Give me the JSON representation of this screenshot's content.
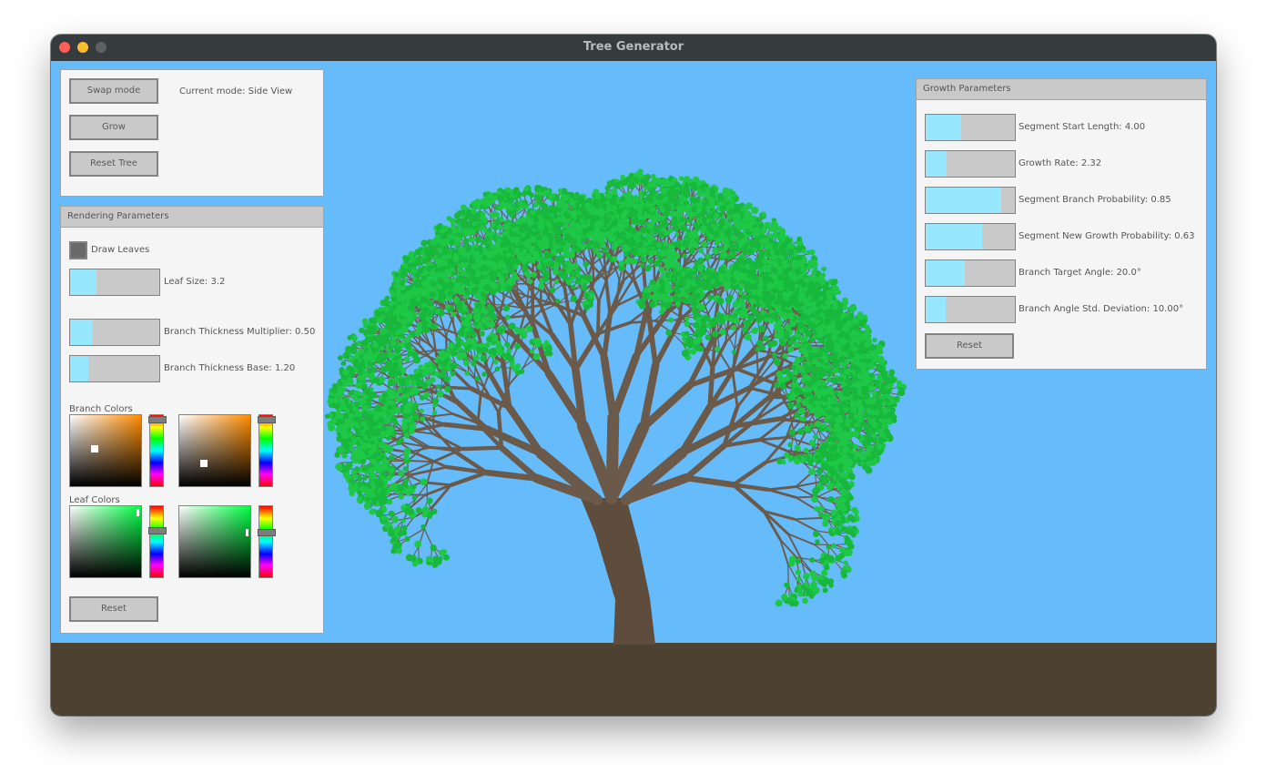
{
  "window": {
    "title": "Tree Generator"
  },
  "colors": {
    "sky": "#66bbfb",
    "ground": "#4d4132",
    "trunk": "#5e4c3c",
    "branch": "#6b5a49",
    "leaf": "#1ec846",
    "slider_fill": "#97e8ff"
  },
  "top_panel": {
    "swap_mode_label": "Swap mode",
    "current_mode_text": "Current mode: Side View",
    "grow_label": "Grow",
    "reset_tree_label": "Reset Tree"
  },
  "rendering": {
    "title": "Rendering Parameters",
    "draw_leaves_label": "Draw Leaves",
    "draw_leaves_checked": true,
    "sliders": [
      {
        "label": "Leaf Size: 3.2",
        "fill": 0.3
      },
      {
        "label": "Branch Thickness Multiplier: 0.50",
        "fill": 0.25
      },
      {
        "label": "Branch Thickness Base: 1.20",
        "fill": 0.2
      }
    ],
    "branch_colors_label": "Branch Colors",
    "leaf_colors_label": "Leaf Colors",
    "branch_pickers": [
      {
        "hue_color": "#ff8c00",
        "saturation": 0.35,
        "value": 0.52,
        "hue_level": 0.07
      },
      {
        "hue_color": "#ff8c00",
        "saturation": 0.35,
        "value": 0.32,
        "hue_level": 0.07
      }
    ],
    "leaf_pickers": [
      {
        "hue_color": "#00ff44",
        "saturation": 0.96,
        "value": 0.91,
        "hue_level": 0.35
      },
      {
        "hue_color": "#00ff44",
        "saturation": 0.96,
        "value": 0.63,
        "hue_level": 0.37
      }
    ],
    "reset_label": "Reset"
  },
  "growth": {
    "title": "Growth Parameters",
    "sliders": [
      {
        "label": "Segment Start Length: 4.00",
        "fill": 0.4
      },
      {
        "label": "Growth Rate: 2.32",
        "fill": 0.23
      },
      {
        "label": "Segment Branch Probability: 0.85",
        "fill": 0.85
      },
      {
        "label": "Segment New Growth Probability: 0.63",
        "fill": 0.63
      },
      {
        "label": "Branch Target Angle: 20.0°",
        "fill": 0.44
      },
      {
        "label": "Branch Angle Std. Deviation: 10.00°",
        "fill": 0.22
      }
    ],
    "reset_label": "Reset"
  }
}
